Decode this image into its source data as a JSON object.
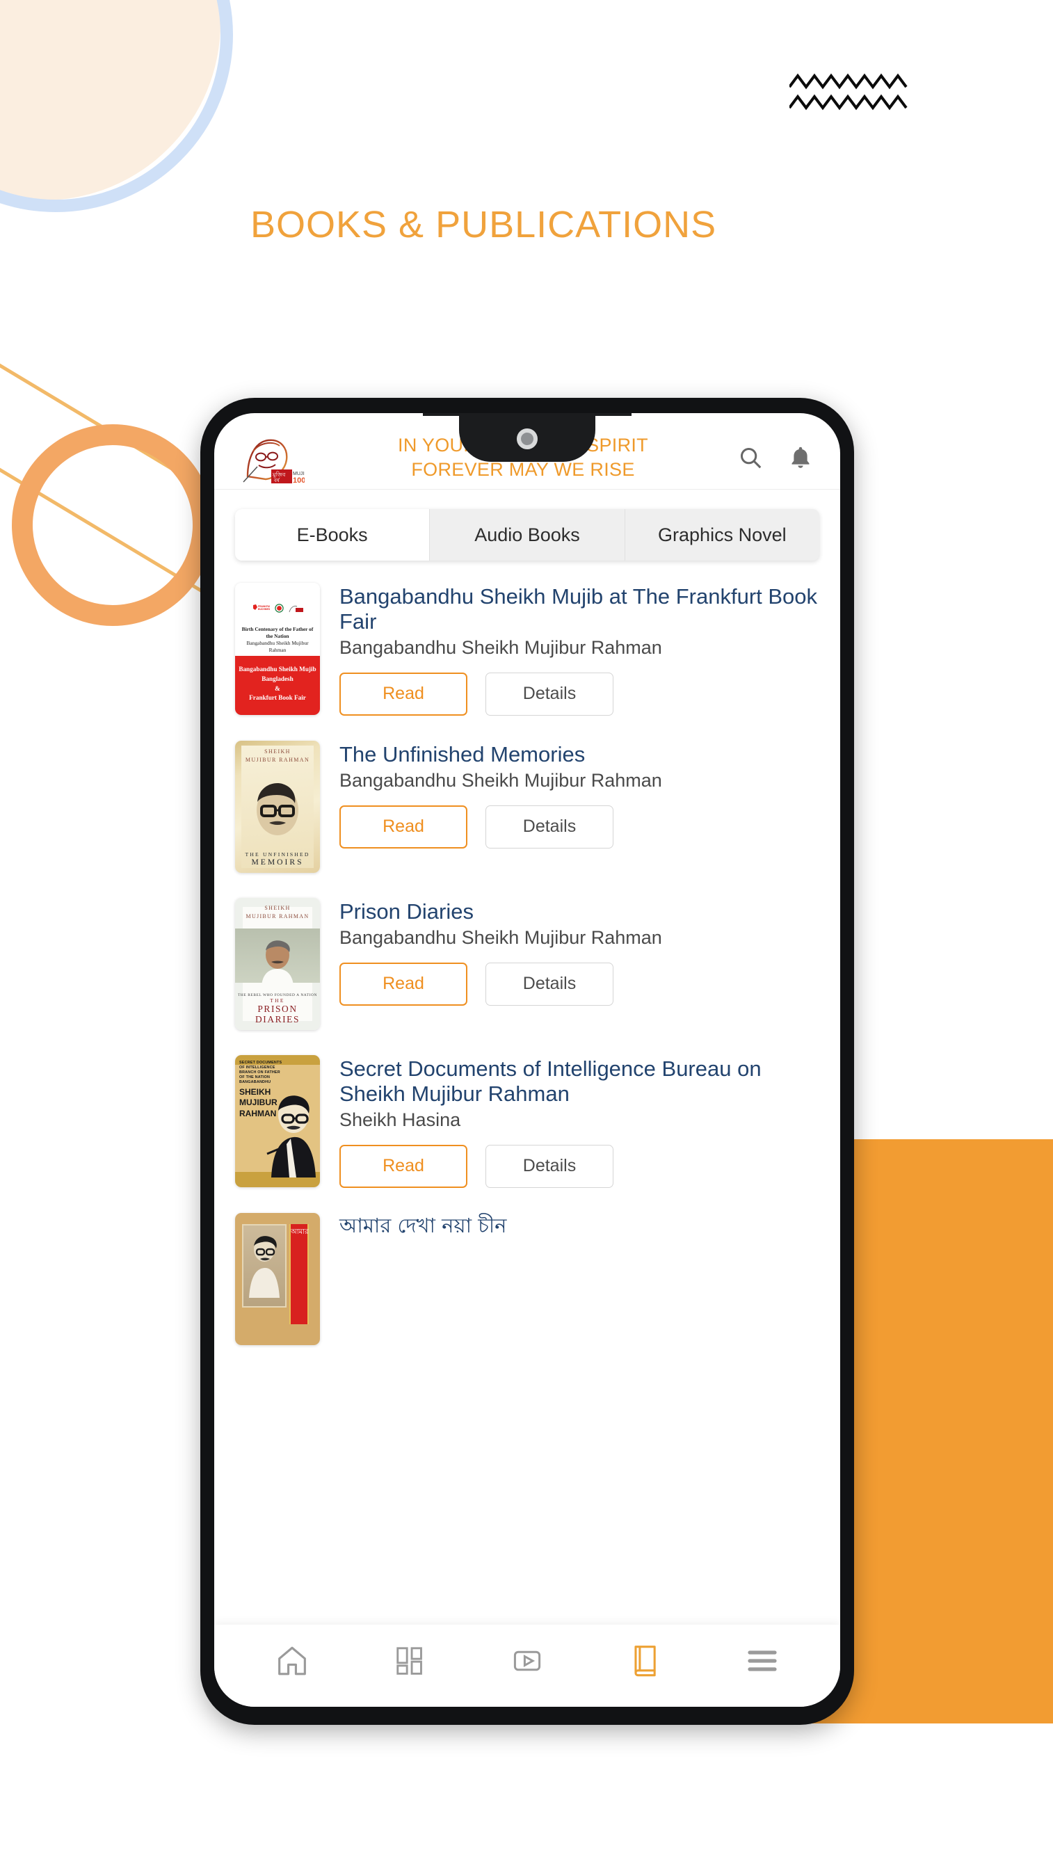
{
  "headline": "BOOKS & PUBLICATIONS",
  "colors": {
    "accent_orange": "#ef9a2b",
    "headline_orange": "#f0a23c",
    "title_navy": "#22436e",
    "read_border": "#ef8f20",
    "block_orange": "#f29c32",
    "cream_circle": "#fbeee0",
    "blue_ring": "#cfe0f7"
  },
  "app": {
    "header": {
      "logo_name": "mujib-100-logo",
      "slogan_line1": "IN YOUR IMMORTAL SPIRIT",
      "slogan_line2": "FOREVER MAY WE RISE",
      "search_icon": "search-icon",
      "notification_icon": "bell-icon"
    },
    "tabs": [
      {
        "label": "E-Books",
        "active": true
      },
      {
        "label": "Audio Books",
        "active": false
      },
      {
        "label": "Graphics Novel",
        "active": false
      }
    ],
    "buttons": {
      "read": "Read",
      "details": "Details"
    },
    "books": [
      {
        "title": "Bangabandhu Sheikh Mujib at The Frankfurt Book Fair",
        "author": "Bangabandhu Sheikh Mujibur Rahman",
        "cover": {
          "style": "frankfurt",
          "top_line1": "Birth Centenary of the Father of the Nation",
          "top_line2": "Bangabandhu Sheikh Mujibur Rahman",
          "bottom_line1": "Bangabandhu Sheikh Mujib",
          "bottom_line2": "Bangladesh",
          "bottom_line3": "&",
          "bottom_line4": "Frankfurt Book Fair"
        }
      },
      {
        "title": "The Unfinished Memories",
        "author": "Bangabandhu Sheikh Mujibur Rahman",
        "cover": {
          "style": "memoirs",
          "name_line1": "SHEIKH",
          "name_line2": "MUJIBUR RAHMAN",
          "bottom_line1": "THE UNFINISHED",
          "bottom_line2": "MEMOIRS"
        }
      },
      {
        "title": "Prison Diaries",
        "author": "Bangabandhu Sheikh Mujibur Rahman",
        "cover": {
          "style": "prison",
          "name_line1": "SHEIKH",
          "name_line2": "MUJIBUR RAHMAN",
          "subtitle": "THE REBEL WHO FOUNDED A NATION",
          "bottom_line1": "THE",
          "bottom_line2": "PRISON",
          "bottom_line3": "DIARIES"
        }
      },
      {
        "title": "Secret Documents of Intelligence Bureau on Sheikh Mujibur Rahman",
        "author": "Sheikh Hasina",
        "cover": {
          "style": "secret",
          "small_lines": "SECRET DOCUMENTS OF INTELLIGENCE BRANCH ON FATHER OF THE NATION BANGABANDHU",
          "big_line1": "SHEIKH",
          "big_line2": "MUJIBUR",
          "big_line3": "RAHMAN"
        }
      },
      {
        "title": "আমার দেখা নয়া চীন",
        "author": "",
        "cover": {
          "style": "china",
          "band_text": "আমার"
        }
      }
    ],
    "bottom_nav": [
      {
        "icon": "home-icon",
        "active": false
      },
      {
        "icon": "grid-icon",
        "active": false
      },
      {
        "icon": "video-play-icon",
        "active": false
      },
      {
        "icon": "book-icon",
        "active": true
      },
      {
        "icon": "hamburger-menu-icon",
        "active": false
      }
    ]
  }
}
